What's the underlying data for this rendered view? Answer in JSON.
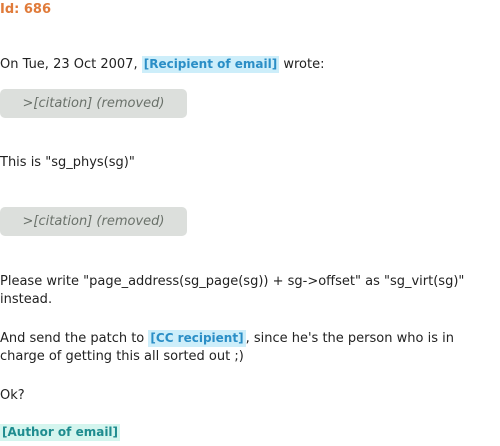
{
  "header": {
    "id_label": "Id: 686"
  },
  "email": {
    "intro_prefix": "On Tue, 23 Oct 2007,",
    "recipient_tag": "[Recipient of email]",
    "intro_suffix": "wrote:",
    "citation_1": ">[citation] (removed)",
    "line_1": "This is \"sg_phys(sg)\"",
    "citation_2": ">[citation] (removed)",
    "paragraph_1": "Please write \"page_address(sg_page(sg)) + sg->offset\" as \"sg_virt(sg)\" instead.",
    "paragraph_2_prefix": "And send the patch to",
    "cc_tag": "[CC recipient]",
    "paragraph_2_suffix": ", since he's the person who is in charge of getting this all sorted out ;)",
    "question": "Ok?",
    "author_tag": "[Author of email]"
  },
  "colors": {
    "id_color": "#e07b3a",
    "tag_background": "#cdeefa",
    "tag_text": "#2a8ec6",
    "author_background": "#d4f5ee",
    "author_text": "#1e8c8f",
    "citation_background": "#dcdfdc",
    "citation_text": "#6a716a"
  }
}
